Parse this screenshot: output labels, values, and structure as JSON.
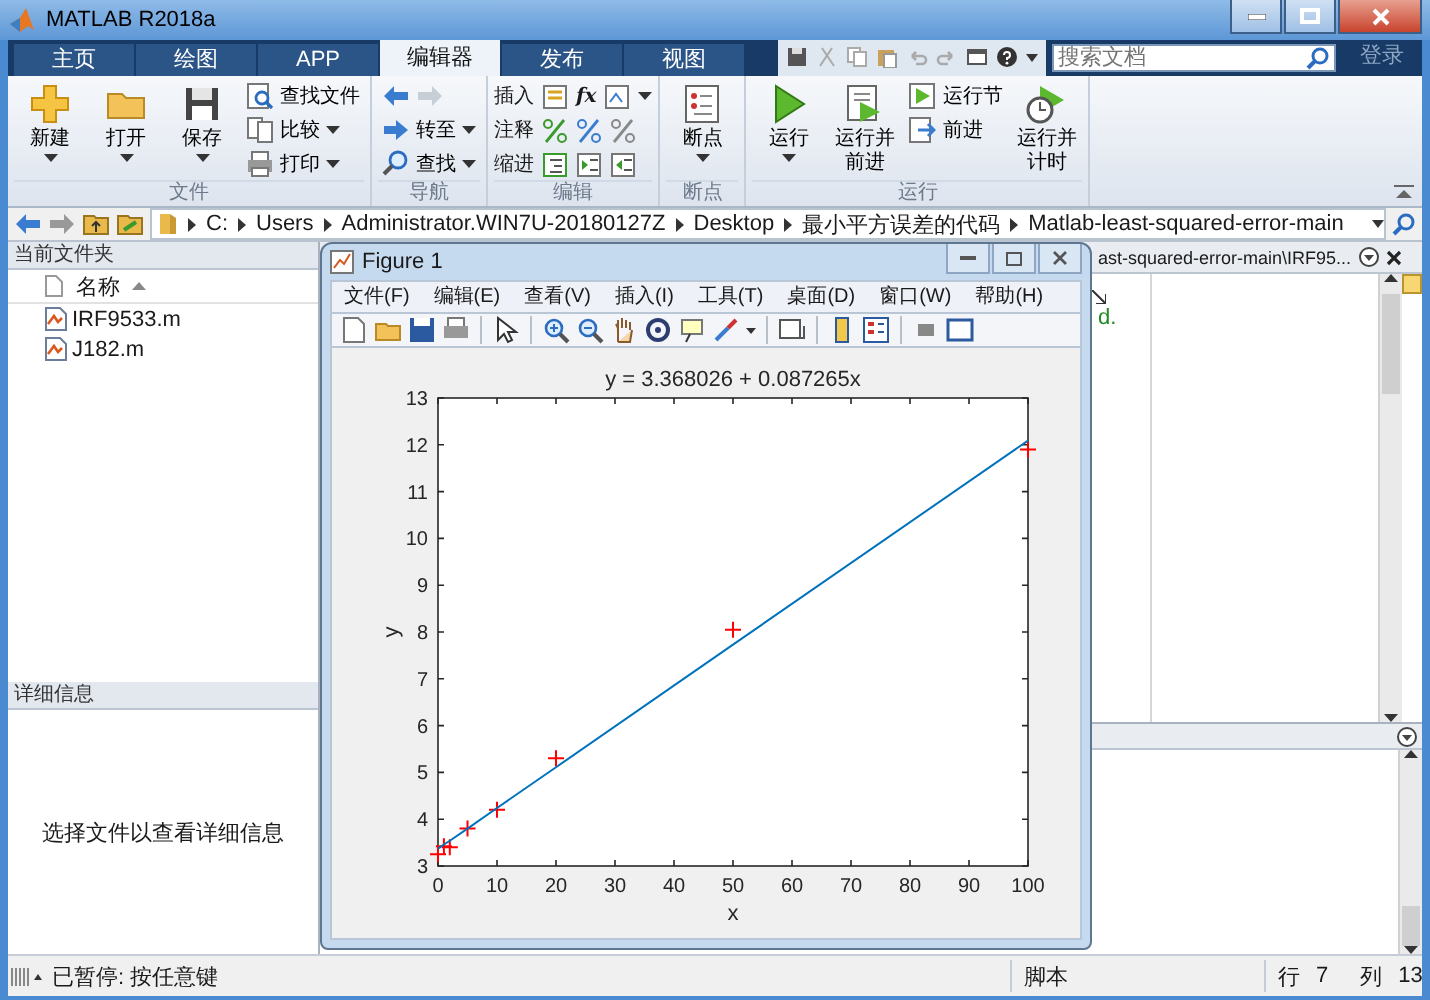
{
  "window": {
    "title": "MATLAB R2018a"
  },
  "tabs": [
    {
      "label": "主页",
      "selected": false
    },
    {
      "label": "绘图",
      "selected": false
    },
    {
      "label": "APP",
      "selected": false
    },
    {
      "label": "编辑器",
      "selected": true
    },
    {
      "label": "发布",
      "selected": false
    },
    {
      "label": "视图",
      "selected": false
    }
  ],
  "search": {
    "placeholder": "搜索文档"
  },
  "login": "登录",
  "ribbon": {
    "groups": [
      {
        "label": "文件",
        "items": [
          {
            "kind": "large",
            "label": "新建",
            "dropdown": true
          },
          {
            "kind": "large",
            "label": "打开",
            "dropdown": true
          },
          {
            "kind": "large",
            "label": "保存",
            "dropdown": true
          },
          {
            "kind": "small",
            "label": "查找文件",
            "dropdown": false
          },
          {
            "kind": "small",
            "label": "比较",
            "dropdown": true
          },
          {
            "kind": "small",
            "label": "打印",
            "dropdown": true
          }
        ]
      },
      {
        "label": "导航",
        "items": [
          {
            "kind": "arrows"
          },
          {
            "kind": "small",
            "label": "转至",
            "dropdown": true
          },
          {
            "kind": "small",
            "label": "查找",
            "dropdown": true
          }
        ]
      },
      {
        "label": "编辑",
        "items": [
          {
            "kind": "row",
            "label": "插入",
            "symbol": "fx",
            "dropdown": true
          },
          {
            "kind": "row",
            "label": "注释",
            "dropdown": false
          },
          {
            "kind": "row",
            "label": "缩进",
            "dropdown": false
          }
        ]
      },
      {
        "label": "断点",
        "items": [
          {
            "kind": "large",
            "label": "断点",
            "dropdown": true
          }
        ]
      },
      {
        "label": "运行",
        "items": [
          {
            "kind": "large",
            "label": "运行",
            "dropdown": true
          },
          {
            "kind": "large",
            "label": "运行并前进",
            "dropdown": false
          },
          {
            "kind": "small",
            "label": "运行节",
            "dropdown": false
          },
          {
            "kind": "small",
            "label": "前进",
            "dropdown": false
          },
          {
            "kind": "large",
            "label": "运行并计时",
            "dropdown": false
          }
        ]
      }
    ]
  },
  "address": {
    "path": [
      "C:",
      "Users",
      "Administrator.WIN7U-20180127Z",
      "Desktop",
      "最小平方误差的代码",
      "Matlab-least-squared-error-main"
    ]
  },
  "current_folder": {
    "title": "当前文件夹",
    "column": "名称",
    "files": [
      "IRF9533.m",
      "J182.m"
    ]
  },
  "details": {
    "title": "详细信息",
    "message": "选择文件以查看详细信息"
  },
  "editor": {
    "tab_title": "ast-squared-error-main\\IRF95...",
    "code_fragment": "d."
  },
  "figure": {
    "title": "Figure 1",
    "menu": [
      "文件(F)",
      "编辑(E)",
      "查看(V)",
      "插入(I)",
      "工具(T)",
      "桌面(D)",
      "窗口(W)",
      "帮助(H)"
    ],
    "chart_data": {
      "type": "scatter",
      "title": "y = 3.368026 + 0.087265x",
      "xlabel": "x",
      "ylabel": "y",
      "x": [
        0,
        1,
        2,
        5,
        10,
        20,
        50,
        100
      ],
      "series": [
        {
          "type": "scatter",
          "color": "#ff0000",
          "values": [
            3.25,
            3.42,
            3.4,
            3.8,
            4.2,
            5.3,
            8.05,
            11.9
          ]
        },
        {
          "type": "line",
          "color": "#0072bd",
          "values": [
            3.37,
            3.46,
            3.54,
            3.8,
            4.24,
            5.11,
            7.73,
            12.09
          ]
        }
      ],
      "xlim": [
        0,
        100
      ],
      "ylim": [
        3,
        13
      ],
      "xticks": [
        0,
        10,
        20,
        30,
        40,
        50,
        60,
        70,
        80,
        90,
        100
      ],
      "yticks": [
        3,
        4,
        5,
        6,
        7,
        8,
        9,
        10,
        11,
        12,
        13
      ]
    }
  },
  "status_bar": {
    "state": "已暂停: 按任意键",
    "file_type": "脚本",
    "line_label": "行",
    "line": "7",
    "column_label": "列",
    "column": "13"
  }
}
